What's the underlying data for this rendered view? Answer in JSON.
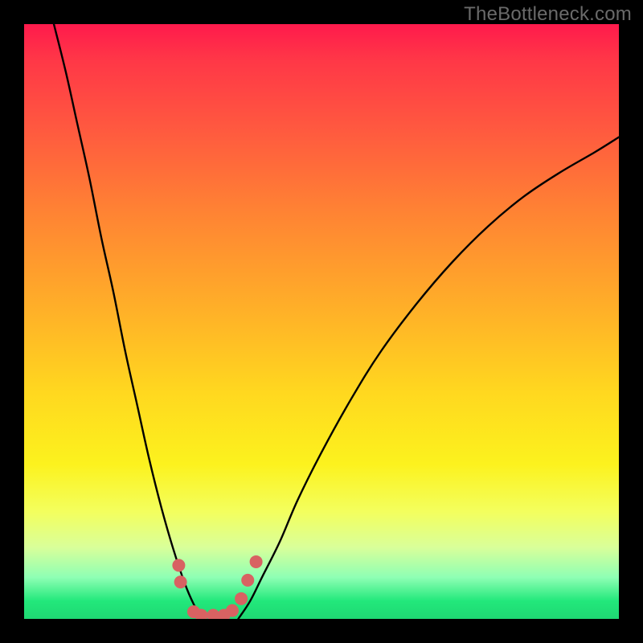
{
  "watermark": "TheBottleneck.com",
  "chart_data": {
    "type": "line",
    "title": "",
    "xlabel": "",
    "ylabel": "",
    "xlim": [
      0,
      100
    ],
    "ylim": [
      0,
      100
    ],
    "grid": false,
    "series": [
      {
        "name": "left-curve",
        "x": [
          5,
          7,
          9,
          11,
          13,
          15,
          17,
          19,
          21,
          23,
          25,
          27,
          28.5,
          30
        ],
        "y": [
          100,
          92,
          83,
          74,
          64,
          55,
          45,
          36,
          27,
          19,
          12,
          6,
          2.5,
          0
        ]
      },
      {
        "name": "right-curve",
        "x": [
          36,
          38,
          40,
          43,
          46,
          50,
          55,
          60,
          66,
          72,
          78,
          84,
          90,
          96,
          100
        ],
        "y": [
          0,
          3,
          7,
          13,
          20,
          28,
          37,
          45,
          53,
          60,
          66,
          71,
          75,
          78.5,
          81
        ]
      }
    ],
    "markers": {
      "name": "dot-cluster",
      "color": "#d86262",
      "radius": 8,
      "points": [
        {
          "x": 26.0,
          "y": 9.0
        },
        {
          "x": 26.3,
          "y": 6.2
        },
        {
          "x": 28.5,
          "y": 1.2
        },
        {
          "x": 29.8,
          "y": 0.6
        },
        {
          "x": 31.8,
          "y": 0.6
        },
        {
          "x": 33.6,
          "y": 0.6
        },
        {
          "x": 35.0,
          "y": 1.4
        },
        {
          "x": 36.5,
          "y": 3.4
        },
        {
          "x": 37.6,
          "y": 6.5
        },
        {
          "x": 39.0,
          "y": 9.6
        }
      ]
    }
  }
}
